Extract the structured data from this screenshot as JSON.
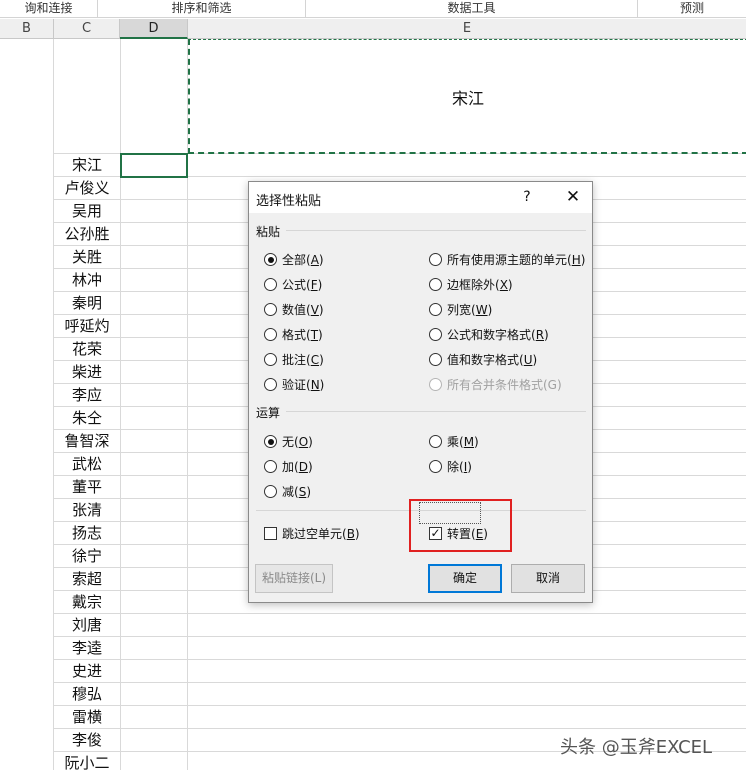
{
  "ribbon": {
    "groups": [
      "询和连接",
      "排序和筛选",
      "数据工具",
      "预测"
    ]
  },
  "columns": [
    "B",
    "C",
    "D",
    "E"
  ],
  "merged_cell_value": "宋江",
  "names": [
    "宋江",
    "卢俊义",
    "吴用",
    "公孙胜",
    "关胜",
    "林冲",
    "秦明",
    "呼延灼",
    "花荣",
    "柴进",
    "李应",
    "朱仝",
    "鲁智深",
    "武松",
    "董平",
    "张清",
    "扬志",
    "徐宁",
    "索超",
    "戴宗",
    "刘唐",
    "李逵",
    "史进",
    "穆弘",
    "雷横",
    "李俊",
    "阮小二"
  ],
  "dialog": {
    "title": "选择性粘贴",
    "help": "?",
    "close": "✕",
    "paste_section": "粘贴",
    "paste_left": [
      {
        "text": "全部(",
        "key": "A",
        "tail": ")",
        "selected": true
      },
      {
        "text": "公式(",
        "key": "F",
        "tail": ")",
        "selected": false
      },
      {
        "text": "数值(",
        "key": "V",
        "tail": ")",
        "selected": false
      },
      {
        "text": "格式(",
        "key": "T",
        "tail": ")",
        "selected": false
      },
      {
        "text": "批注(",
        "key": "C",
        "tail": ")",
        "selected": false
      },
      {
        "text": "验证(",
        "key": "N",
        "tail": ")",
        "selected": false
      }
    ],
    "paste_right": [
      {
        "text": "所有使用源主题的单元(",
        "key": "H",
        "tail": ")",
        "selected": false
      },
      {
        "text": "边框除外(",
        "key": "X",
        "tail": ")",
        "selected": false
      },
      {
        "text": "列宽(",
        "key": "W",
        "tail": ")",
        "selected": false
      },
      {
        "text": "公式和数字格式(",
        "key": "R",
        "tail": ")",
        "selected": false
      },
      {
        "text": "值和数字格式(",
        "key": "U",
        "tail": ")",
        "selected": false
      },
      {
        "text": "所有合并条件格式(G)",
        "key": "",
        "tail": "",
        "selected": false,
        "disabled": true
      }
    ],
    "op_section": "运算",
    "op_left": [
      {
        "text": "无(",
        "key": "O",
        "tail": ")",
        "selected": true
      },
      {
        "text": "加(",
        "key": "D",
        "tail": ")",
        "selected": false
      },
      {
        "text": "减(",
        "key": "S",
        "tail": ")",
        "selected": false
      }
    ],
    "op_right": [
      {
        "text": "乘(",
        "key": "M",
        "tail": ")",
        "selected": false
      },
      {
        "text": "除(",
        "key": "I",
        "tail": ")",
        "selected": false
      }
    ],
    "skip_blanks": {
      "text": "跳过空单元(",
      "key": "B",
      "tail": ")",
      "checked": false
    },
    "transpose": {
      "text": "转置(",
      "key": "E",
      "tail": ")",
      "checked": true,
      "mark": "✓"
    },
    "paste_link_label": "粘贴链接(L)",
    "ok_label": "确定",
    "cancel_label": "取消"
  },
  "watermark": "头条 @玉斧EXCEL",
  "colors": {
    "accent": "#217346",
    "highlight": "#e02020",
    "dialog_bg": "#f0f0f0",
    "primary_border": "#0078d7"
  }
}
